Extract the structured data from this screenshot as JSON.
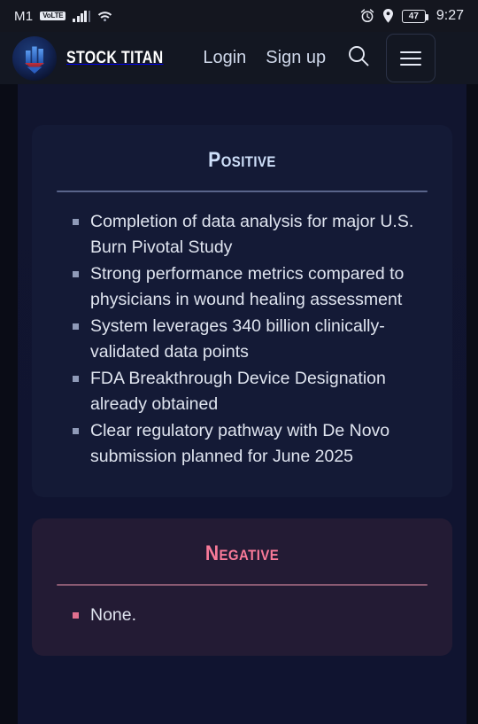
{
  "statusbar": {
    "carrier": "M1",
    "network_badge": "VoLTE",
    "signal_icon": "signal-bars-icon",
    "wifi_icon": "wifi-icon",
    "alarm_icon": "alarm-clock-icon",
    "location_icon": "location-pin-icon",
    "battery_level": "47",
    "time": "9:27"
  },
  "navbar": {
    "logo_icon": "stock-titan-logo-icon",
    "brand": "STOCK TITAN",
    "login_label": "Login",
    "signup_label": "Sign up",
    "search_icon": "search-icon",
    "menu_icon": "hamburger-menu-icon"
  },
  "cards": {
    "positive": {
      "title": "Positive",
      "accent": "#cfe0fa",
      "items": [
        "Completion of data analysis for major U.S. Burn Pivotal Study",
        "Strong performance metrics compared to physicians in wound healing assessment",
        "System leverages 340 billion clinically-validated data points",
        "FDA Breakthrough Device Designation already obtained",
        "Clear regulatory pathway with De Novo submission planned for June 2025"
      ]
    },
    "negative": {
      "title": "Negative",
      "accent": "#f97a99",
      "items": [
        "None."
      ]
    }
  }
}
